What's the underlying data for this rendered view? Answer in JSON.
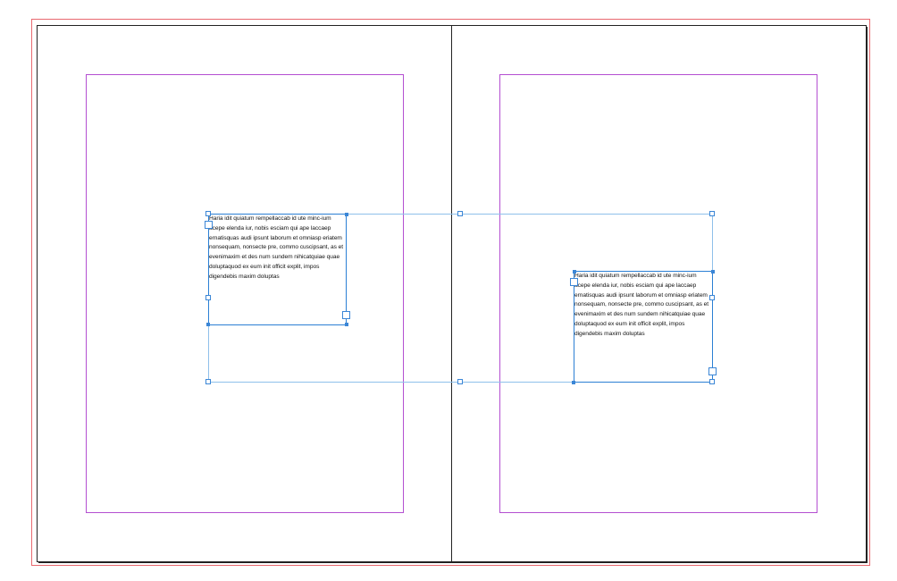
{
  "document": {
    "pages": [
      "left-page",
      "right-page"
    ],
    "colors": {
      "bleed_guide": "#e8696f",
      "margin_guide": "#b44fd1",
      "frame_selection": "#2b7fd4",
      "group_bounds": "#8fc0ea"
    }
  },
  "text_frames": [
    {
      "name": "left-text-frame",
      "content": "Haria idit quiatum rempellaccab id ute minc-ium acepe elenda iur, nobis esciam qui ape laccaep ernatisquas audi ipsunt laborum et omniasp eriatem nonsequam, nonsecte pre, commo cuscipsant, as et evenimaxim et des num sundem nihicatquiae quae doluptaquod ex eum init officit explit, impos digendebis maxim doluptas"
    },
    {
      "name": "right-text-frame",
      "content": "Haria idit quiatum rempellaccab id ute minc-ium acepe elenda iur, nobis esciam qui ape laccaep ernatisquas audi ipsunt laborum et omniasp eriatem nonsequam, nonsecte pre, commo cuscipsant, as et evenimaxim et des num sundem nihicatquiae quae doluptaquod ex eum init officit explit, impos digendebis maxim doluptas"
    }
  ]
}
